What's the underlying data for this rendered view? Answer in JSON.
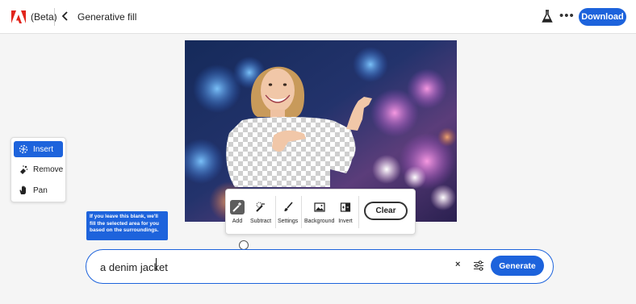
{
  "header": {
    "beta_label": "(Beta)",
    "page_title": "Generative fill",
    "download_label": "Download",
    "icons": {
      "logo": "adobe-logo",
      "back": "chevron-left-icon",
      "labs": "flask-icon",
      "more": "more-icon"
    },
    "more_glyph": "•••"
  },
  "tool_panel": {
    "items": [
      {
        "label": "Insert",
        "icon": "insert-icon",
        "active": true
      },
      {
        "label": "Remove",
        "icon": "remove-icon",
        "active": false
      },
      {
        "label": "Pan",
        "icon": "hand-icon",
        "active": false
      }
    ]
  },
  "floating_toolbar": {
    "items": [
      {
        "label": "Add",
        "icon": "brush-add-icon",
        "active": true
      },
      {
        "label": "Subtract",
        "icon": "brush-subtract-icon",
        "active": false
      },
      {
        "label": "Settings",
        "icon": "brush-icon",
        "active": false
      },
      {
        "label": "Background",
        "icon": "image-icon",
        "active": false
      },
      {
        "label": "Invert",
        "icon": "invert-icon",
        "active": false
      }
    ],
    "clear_label": "Clear"
  },
  "tooltip": {
    "text": "If you leave this blank, we'll fill the selected area for you based on the surroundings."
  },
  "prompt": {
    "value": "a denim jacket",
    "clear_glyph": "×",
    "generate_label": "Generate"
  },
  "colors": {
    "accent": "#1d63dc",
    "page_bg": "#f5f5f5"
  }
}
